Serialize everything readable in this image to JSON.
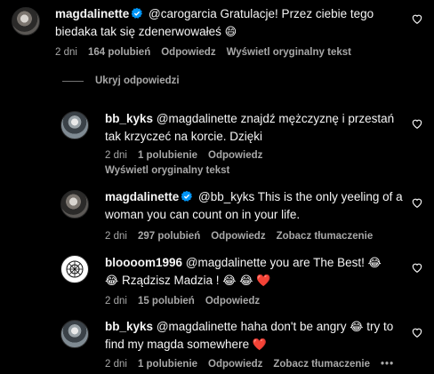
{
  "comments": [
    {
      "username": "magdalinette",
      "text": "@carogarcia Gratulacje! Przez ciebie tego biedaka tak się zdenerwowałeś",
      "emoji_end": "😄",
      "time": "2 dni",
      "likes": "164 polubień",
      "reply": "Odpowiedz",
      "translate": "Wyświetl oryginalny tekst"
    },
    {
      "username": "bb_kyks",
      "text": "@magdalinette znajdź mężczyznę i przestań tak krzyczeć na korcie. Dzięki",
      "time": "2 dni",
      "likes": "1 polubienie",
      "reply": "Odpowiedz",
      "translate": "Wyświetl oryginalny tekst"
    },
    {
      "username": "magdalinette",
      "text": "@bb_kyks This is the only yeeling of a woman you can count on in your life.",
      "time": "2 dni",
      "likes": "297 polubień",
      "reply": "Odpowiedz",
      "translate": "Zobacz tłumaczenie"
    },
    {
      "username": "bloooom1996",
      "text_a": "@magdalinette you are The Best!",
      "text_b": "Rządzisz Madzia !",
      "time": "2 dni",
      "likes": "15 polubień",
      "reply": "Odpowiedz"
    },
    {
      "username": "bb_kyks",
      "text_a": "@magdalinette haha don't be angry",
      "text_b": "try to find my magda somewhere",
      "time": "2 dni",
      "likes": "1 polubienie",
      "reply": "Odpowiedz",
      "translate": "Zobacz tłumaczenie",
      "more": "•••"
    }
  ],
  "hide_replies": "Ukryj odpowiedzi",
  "icons": {
    "verified": "verified-badge-icon",
    "heart_outline": "heart-outline-icon",
    "heart_red": "red-heart-emoji",
    "laughing": "laughing-emoji",
    "smile": "smiling-emoji"
  },
  "colors": {
    "background": "#000000",
    "verified_blue": "#0095f6",
    "muted_text": "#a8a8a8",
    "heart_red": "#ff3040"
  }
}
